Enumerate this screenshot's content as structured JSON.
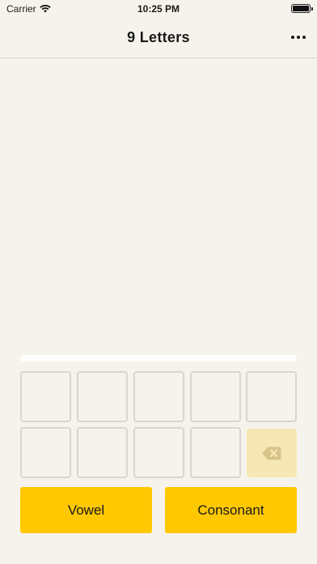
{
  "status_bar": {
    "carrier": "Carrier",
    "time": "10:25 PM"
  },
  "nav": {
    "title": "9 Letters",
    "more_icon": "ellipsis-icon"
  },
  "progress": {
    "value": 0
  },
  "letter_grid": {
    "slots": [
      "",
      "",
      "",
      "",
      "",
      "",
      "",
      "",
      ""
    ],
    "delete_icon": "backspace-icon"
  },
  "actions": {
    "vowel_label": "Vowel",
    "consonant_label": "Consonant"
  },
  "colors": {
    "background": "#f6f3ec",
    "accent": "#ffc800",
    "delete_bg": "#f6e8b4",
    "tile_border": "#d9d6cf"
  }
}
